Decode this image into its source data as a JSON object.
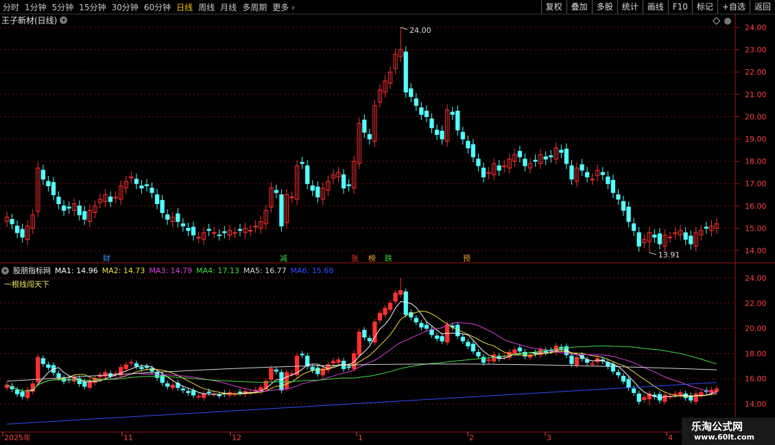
{
  "toolbar": {
    "periods": [
      "分时",
      "1分钟",
      "5分钟",
      "15分钟",
      "30分钟",
      "60分钟",
      "日线",
      "周线",
      "月线",
      "多周期",
      "更多"
    ],
    "active_period": "日线",
    "more_arrow": "›",
    "right_tools": [
      "复权",
      "叠加",
      "多股",
      "统计",
      "画线",
      "F10",
      "标记",
      "+自选",
      "返回"
    ]
  },
  "stock": {
    "title": "王子新材(日线)",
    "dropdown_icon": "chevron-down-icon"
  },
  "main_chart": {
    "price_axis": [
      "24.00",
      "23.00",
      "22.00",
      "21.00",
      "20.00",
      "19.00",
      "18.00",
      "17.00",
      "16.00",
      "15.00",
      "14.00"
    ],
    "high_label": "24.00",
    "low_label": "13.91",
    "event_markers": [
      {
        "text": "财",
        "color": "#3b8fff"
      },
      {
        "text": "减",
        "color": "#40d040"
      },
      {
        "text": "张",
        "color": "#ff3030"
      },
      {
        "text": "榜",
        "color": "#f0a030"
      },
      {
        "text": "跌",
        "color": "#40d040"
      },
      {
        "text": "预",
        "color": "#f0a030"
      }
    ]
  },
  "indicator": {
    "name": "股朋指标网",
    "ma": [
      {
        "label": "MA1: 14.96",
        "color": "#ffffff"
      },
      {
        "label": "MA2: 14.73",
        "color": "#f0e040"
      },
      {
        "label": "MA3: 14.79",
        "color": "#e040e0"
      },
      {
        "label": "MA4: 17.13",
        "color": "#40e040"
      },
      {
        "label": "MA5: 16.77",
        "color": "#d8d8d8"
      },
      {
        "label": "MA6: 15.68",
        "color": "#3050ff"
      }
    ],
    "subtitle": "一根线闯天下",
    "price_axis": [
      "24.00",
      "22.00",
      "20.00",
      "18.00",
      "16.00",
      "14.00"
    ]
  },
  "time_axis": [
    "2025年",
    "11",
    "12",
    "1",
    "2",
    "3",
    "4"
  ],
  "watermark": {
    "line1": "乐淘公式网",
    "line2": "www.60lt.com"
  },
  "colors": {
    "up": "#ff3030",
    "down": "#54ffff",
    "grid": "#7a1010",
    "axis": "#a01818"
  }
}
